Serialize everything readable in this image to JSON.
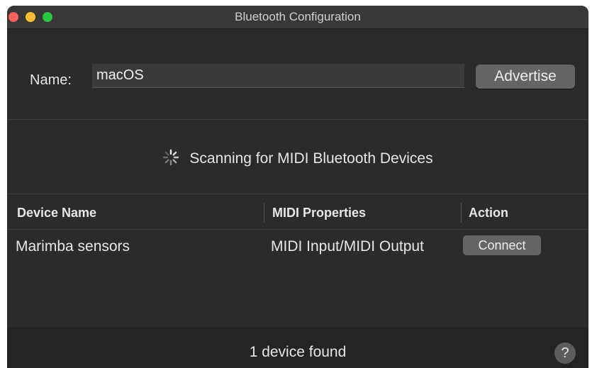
{
  "window": {
    "title": "Bluetooth Configuration"
  },
  "name_section": {
    "label": "Name:",
    "value": "macOS",
    "advertise_label": "Advertise"
  },
  "scan": {
    "status": "Scanning for MIDI Bluetooth Devices",
    "icon": "spinner-icon"
  },
  "table": {
    "columns": [
      "Device Name",
      "MIDI Properties",
      "Action"
    ],
    "rows": [
      {
        "device_name": "Marimba sensors",
        "midi_properties": "MIDI Input/MIDI Output",
        "action_label": "Connect"
      }
    ]
  },
  "footer": {
    "status": "1 device found",
    "help_label": "?"
  },
  "colors": {
    "window_bg": "#2b2b2b",
    "titlebar_bg": "#383838",
    "button_bg": "#646464",
    "close": "#fe5f57",
    "minimize": "#febc2e",
    "zoom": "#28c840"
  }
}
